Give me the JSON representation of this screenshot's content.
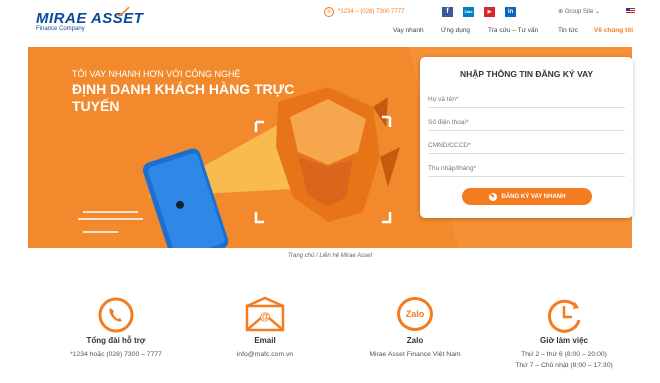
{
  "header": {
    "logo_main": "MIRAE ASSET",
    "logo_sub": "Finance Company",
    "hotline": "*1234 – (028) 7300 7777",
    "social": [
      {
        "icon": "facebook-icon",
        "label": "f",
        "color": "#3b5998"
      },
      {
        "icon": "zalo-icon",
        "label": "Zalo",
        "color": "#0180c7"
      },
      {
        "icon": "youtube-icon",
        "label": "▶",
        "color": "#d9252a"
      },
      {
        "icon": "linkedin-icon",
        "label": "in",
        "color": "#0a66c2"
      }
    ],
    "group_site": "⊕ Group Site ⌄",
    "nav": [
      "Vay nhanh",
      "Ứng dụng",
      "Tra cứu – Tư vấn",
      "Tin tức",
      "Về chúng tôi"
    ]
  },
  "hero": {
    "tagline": "TÔI VAY NHANH HƠN VỚI CÔNG NGHỆ",
    "headline": "ĐỊNH DANH KHÁCH HÀNG TRỰC TUYẾN"
  },
  "form": {
    "title": "NHẬP THÔNG TIN ĐĂNG KÝ VAY",
    "fields": [
      "Họ và tên*",
      "Số điện thoại*",
      "CMND/CCCD*",
      "Thu nhập/tháng*"
    ],
    "submit": "ĐĂNG KÝ VAY NHANH"
  },
  "breadcrumb": "Trang chủ / Liên hệ Mirae Asset",
  "contacts": [
    {
      "icon": "phone-icon",
      "title": "Tổng đài hỗ trợ",
      "lines": [
        "*1234 hoặc (028) 7300 – 7777"
      ]
    },
    {
      "icon": "email-icon",
      "title": "Email",
      "lines": [
        "info@mafc.com.vn"
      ]
    },
    {
      "icon": "zalo-icon",
      "icon_text": "Zalo",
      "title": "Zalo",
      "lines": [
        "Mirae Asset Finance Việt Nam"
      ]
    },
    {
      "icon": "clock-icon",
      "title": "Giờ làm việc",
      "lines": [
        "Thứ 2 – thứ 6 (8:00 – 20:00)",
        "Thứ 7 – Chủ nhật (8:00 – 17:30)"
      ]
    }
  ],
  "colors": {
    "accent": "#f47b20",
    "brand": "#0a4a9a"
  }
}
